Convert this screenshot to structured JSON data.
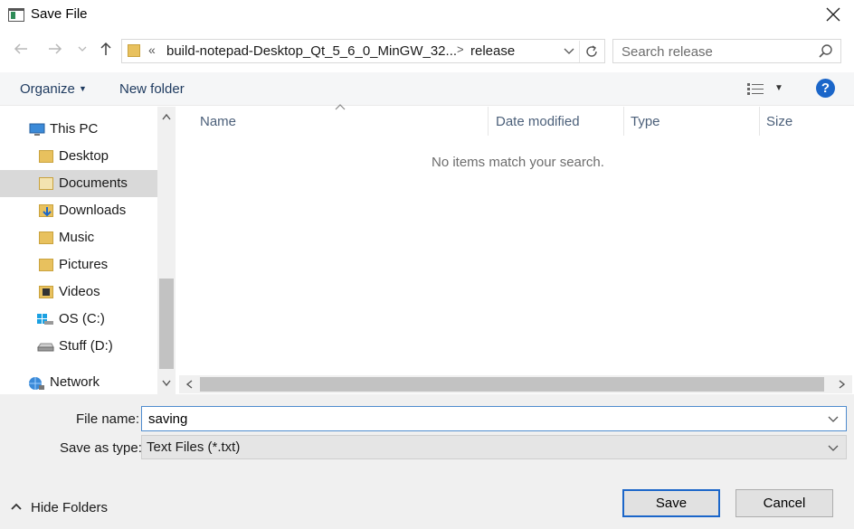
{
  "window": {
    "title": "Save File"
  },
  "address_bar": {
    "overflow_glyph": "«",
    "segments": [
      "build-notepad-Desktop_Qt_5_6_0_MinGW_32...",
      "release"
    ],
    "separator": ">"
  },
  "search": {
    "placeholder": "Search release",
    "value": ""
  },
  "toolbar": {
    "organize_label": "Organize",
    "new_folder_label": "New folder",
    "help_label": "?"
  },
  "nav_pane": {
    "items": [
      {
        "label": "This PC",
        "icon": "computer-icon"
      },
      {
        "label": "Desktop",
        "icon": "desktop-folder-icon"
      },
      {
        "label": "Documents",
        "icon": "documents-folder-icon",
        "selected": true
      },
      {
        "label": "Downloads",
        "icon": "downloads-folder-icon"
      },
      {
        "label": "Music",
        "icon": "music-folder-icon"
      },
      {
        "label": "Pictures",
        "icon": "pictures-folder-icon"
      },
      {
        "label": "Videos",
        "icon": "videos-folder-icon"
      },
      {
        "label": "OS (C:)",
        "icon": "windows-drive-icon"
      },
      {
        "label": "Stuff (D:)",
        "icon": "drive-icon"
      },
      {
        "label": "Network",
        "icon": "network-icon"
      }
    ]
  },
  "file_list": {
    "columns": [
      "Name",
      "Date modified",
      "Type",
      "Size"
    ],
    "empty_message": "No items match your search."
  },
  "save_panel": {
    "file_name_label": "File name:",
    "file_name_value": "saving",
    "save_as_type_label": "Save as type:",
    "save_as_type_value": "Text Files (*.txt)",
    "hide_folders_label": "Hide Folders",
    "save_label": "Save",
    "cancel_label": "Cancel"
  },
  "colors": {
    "accent": "#1b66c9",
    "selected_bg": "#d9d9d9",
    "panel_bg": "#f0f0f0"
  }
}
